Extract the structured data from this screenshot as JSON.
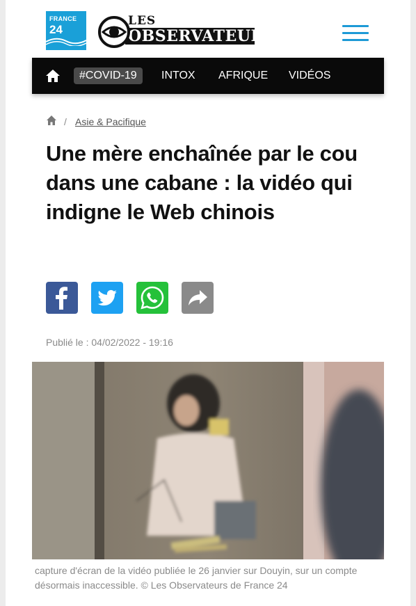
{
  "header": {
    "france24_line1": "FRANCE",
    "france24_line2": "24",
    "observateurs_small": "LES",
    "observateurs_big": "OBSERVATEURS"
  },
  "nav": {
    "items": [
      "#COVID-19",
      "INTOX",
      "AFRIQUE",
      "VIDÉOS"
    ]
  },
  "breadcrumb": {
    "separator": "/",
    "section": "Asie & Pacifique"
  },
  "article": {
    "title": "Une mère enchaînée par le cou dans une cabane : la vidéo qui indigne le Web chinois",
    "published": "Publié le : 04/02/2022 - 19:16",
    "caption": "capture d'écran de la vidéo publiée le 26 janvier sur Douyin, sur un compte désormais inaccessible. © Les Observateurs de France 24"
  },
  "share": [
    {
      "name": "facebook",
      "color": "#3b5998"
    },
    {
      "name": "twitter",
      "color": "#1da1f2"
    },
    {
      "name": "whatsapp",
      "color": "#25c13a"
    },
    {
      "name": "share",
      "color": "#8a8a8a"
    }
  ],
  "colors": {
    "brand_blue": "#1aa0d8",
    "nav_bg": "#0a0a0a",
    "nav_active": "#4a4a4a"
  }
}
